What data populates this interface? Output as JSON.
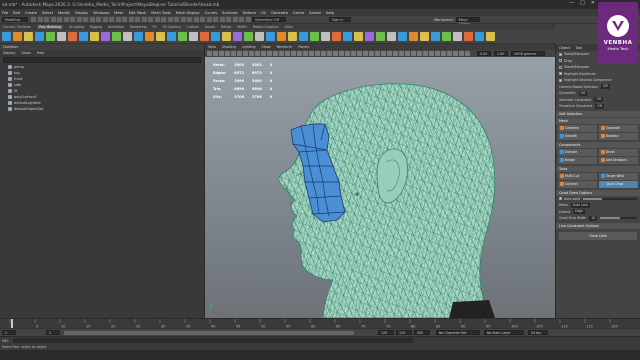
{
  "window": {
    "title": "ad.mb* - Autodesk Maya 2020.3: G:\\Venbha_Media_Tech\\Project\\Maya\\Beginer Tutorial\\Render\\head.mb",
    "workspace_label": "Workspace:",
    "workspace_value": "Maya Classic"
  },
  "menubar": [
    "File",
    "Edit",
    "Create",
    "Select",
    "Modify",
    "Display",
    "Windows",
    "Mesh",
    "Edit Mesh",
    "Mesh Tools",
    "Mesh Display",
    "Curves",
    "Surfaces",
    "Deform",
    "UV",
    "Generate",
    "Cache",
    "Arnold",
    "Help"
  ],
  "statusline": {
    "mode": "Modeling",
    "symmetry": "Symmetry: Off",
    "signin": "Sign In"
  },
  "shelf": {
    "tabs": [
      "Curves / Surfaces",
      "Poly Modeling",
      "Sculpting",
      "Rigging",
      "Animation",
      "Rendering",
      "FX",
      "FX Caching",
      "Custom",
      "Arnold",
      "Bifrost",
      "MASH",
      "Motion Graphics",
      "XGen"
    ],
    "active_tab": "Poly Modeling",
    "icon_colors": [
      "#3a9ad9",
      "#e08a2e",
      "#d9c04a",
      "#3a9ad9",
      "#6cc04a",
      "#c0c0c0",
      "#e06a3a",
      "#3a9ad9",
      "#d9c04a",
      "#9a6ad9",
      "#6cc04a",
      "#c0c0c0",
      "#3a9ad9",
      "#e08a2e",
      "#d9c04a",
      "#3a9ad9",
      "#6cc04a",
      "#c0c0c0",
      "#e06a3a",
      "#3a9ad9",
      "#d9c04a",
      "#9a6ad9",
      "#6cc04a",
      "#c0c0c0",
      "#3a9ad9",
      "#e08a2e",
      "#d9c04a",
      "#3a9ad9",
      "#6cc04a",
      "#c0c0c0",
      "#e06a3a",
      "#3a9ad9",
      "#d9c04a",
      "#9a6ad9",
      "#6cc04a",
      "#c0c0c0",
      "#3a9ad9",
      "#e08a2e",
      "#d9c04a",
      "#3a9ad9",
      "#6cc04a",
      "#c0c0c0",
      "#e06a3a",
      "#3a9ad9",
      "#d9c04a"
    ]
  },
  "outliner": {
    "title": "Outliner",
    "menu": [
      "Display",
      "Show",
      "Help"
    ],
    "items": [
      {
        "label": "persp",
        "icon": "camera-icon"
      },
      {
        "label": "top",
        "icon": "camera-icon"
      },
      {
        "label": "front",
        "icon": "camera-icon"
      },
      {
        "label": "side",
        "icon": "camera-icon"
      },
      {
        "label": "lft",
        "icon": "mesh-icon"
      },
      {
        "label": "polySurface1",
        "icon": "mesh-icon"
      },
      {
        "label": "defaultLightSet",
        "icon": "set-icon"
      },
      {
        "label": "defaultObjectSet",
        "icon": "set-icon"
      }
    ]
  },
  "viewport": {
    "menu": [
      "View",
      "Shading",
      "Lighting",
      "Show",
      "Renderer",
      "Panels"
    ],
    "gamma_label": "sRGB gamma",
    "exposure": "0.00",
    "gamma_value": "1.00",
    "hud": [
      {
        "label": "Verts:",
        "a": "3503",
        "b": "3503",
        "c": "0"
      },
      {
        "label": "Edges:",
        "a": "6972",
        "b": "6972",
        "c": "0"
      },
      {
        "label": "Faces:",
        "a": "3490",
        "b": "3490",
        "c": "0"
      },
      {
        "label": "Tris:",
        "a": "6896",
        "b": "6896",
        "c": "0"
      },
      {
        "label": "UVs:",
        "a": "3706",
        "b": "3706",
        "c": "0"
      }
    ]
  },
  "attribute": {
    "tabs": [
      "Object",
      "Tool"
    ],
    "rows_top": [
      {
        "label": "Tweak/Marquee",
        "checked": true
      },
      {
        "label": "Drag",
        "checked": false
      },
      {
        "label": "Tweak/Marquee",
        "checked": false
      },
      {
        "label": "Highlight Backfaces",
        "checked": true
      },
      {
        "label": "Highlight Nearest Component",
        "checked": true
      }
    ],
    "camera_based": "Camera Based Selection",
    "camera_off": "Off",
    "symmetry_label": "Symmetry",
    "symmetry_value": "Off",
    "selection_constraint": "Selection Constraint",
    "selection_constraint_value": "Off",
    "transform_constraint": "Transform Constraint",
    "transform_constraint_value": "Off",
    "soft_selection": "Soft Selection",
    "mesh_section": "Mesh",
    "mesh_buttons": [
      {
        "label": "Combine",
        "color": "#d9863a"
      },
      {
        "label": "Separate",
        "color": "#d9863a"
      },
      {
        "label": "Smooth",
        "color": "#3a9ad9"
      },
      {
        "label": "Boolean",
        "color": "#d9863a"
      }
    ],
    "components_section": "Components",
    "component_buttons": [
      {
        "label": "Extrude",
        "color": "#3a9ad9"
      },
      {
        "label": "Bevel",
        "color": "#d9863a"
      },
      {
        "label": "Bridge",
        "color": "#3a9ad9"
      },
      {
        "label": "Add Divisions",
        "color": "#d9863a"
      }
    ],
    "tools_section": "Tools",
    "tool_buttons": [
      {
        "label": "Multi-Cut",
        "color": "#d9863a",
        "active": false
      },
      {
        "label": "Target Weld",
        "color": "#3a9ad9",
        "active": false
      },
      {
        "label": "Connect",
        "color": "#d9863a",
        "active": false
      },
      {
        "label": "Quad Draw",
        "color": "#3a9ad9",
        "active": true
      }
    ],
    "quad_draw_options": "Quad Draw Options",
    "auto_weld": "Auto weld",
    "auto_weld_value": 0.35,
    "relax_label": "Relax",
    "relax_value": "Auto Lock",
    "extend_label": "Extend",
    "extend_value": "Edge",
    "strip_label": "Quad Strip Width",
    "strip_value": "10",
    "strip_fraction": 0.55,
    "live_constraint": "Live Constraint Options",
    "clear_btn": "Clear Defs"
  },
  "timeline": {
    "ticks": [
      "0",
      "5",
      "10",
      "15",
      "20",
      "25",
      "30",
      "35",
      "40",
      "45",
      "50",
      "55",
      "60",
      "65",
      "70",
      "75",
      "80",
      "85",
      "90",
      "95",
      "100",
      "105",
      "110",
      "115",
      "120"
    ],
    "current": "1"
  },
  "range": {
    "start": "1",
    "start2": "1",
    "end": "120",
    "end2": "120",
    "end3": "200",
    "character_set": "No Character Set",
    "anim_layer": "No Anim Layer",
    "fps": "24 fps"
  },
  "helpline": "Select Tool: select an object"
}
